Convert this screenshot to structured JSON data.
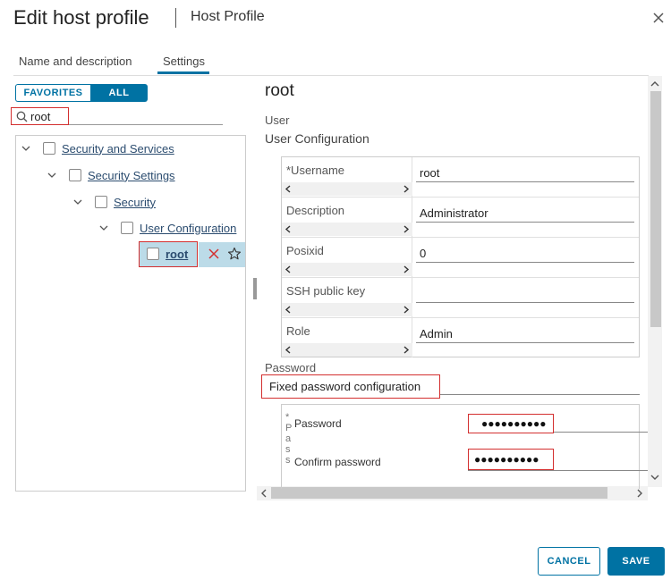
{
  "dialog": {
    "title": "Edit host profile",
    "subtitle": "Host Profile"
  },
  "tabs": [
    {
      "label": "Name and description",
      "active": false
    },
    {
      "label": "Settings",
      "active": true
    }
  ],
  "filter": {
    "favorites_label": "FAVORITES",
    "all_label": "ALL",
    "selected": "ALL",
    "search_value": "root"
  },
  "tree": {
    "nodes": [
      {
        "label": "Security and Services",
        "expanded": true,
        "checked": false
      },
      {
        "label": "Security Settings",
        "expanded": true,
        "checked": false
      },
      {
        "label": "Security",
        "expanded": true,
        "checked": false
      },
      {
        "label": "User Configuration",
        "expanded": true,
        "checked": false
      },
      {
        "label": "root",
        "checked": false,
        "selected": true
      }
    ]
  },
  "detail": {
    "title": "root",
    "section": "User",
    "subsection": "User Configuration",
    "fields": [
      {
        "label": "*Username",
        "value": "root"
      },
      {
        "label": "Description",
        "value": "Administrator"
      },
      {
        "label": "Posixid",
        "value": "0"
      },
      {
        "label": "SSH public key",
        "value": ""
      },
      {
        "label": "Role",
        "value": "Admin"
      }
    ],
    "password_section": "Password",
    "password_option": "Fixed password configuration",
    "password_clipped_text": "* P a s s",
    "password_label": "Password",
    "confirm_password_label": "Confirm password",
    "password_mask": "●●●●●●●●●●",
    "confirm_password_mask": "●●●●●●●●●●"
  },
  "footer": {
    "cancel_label": "CANCEL",
    "save_label": "SAVE"
  },
  "colors": {
    "accent": "#0072a3",
    "highlight_border": "#d32f2f",
    "selected_row": "#bcdbe8"
  }
}
